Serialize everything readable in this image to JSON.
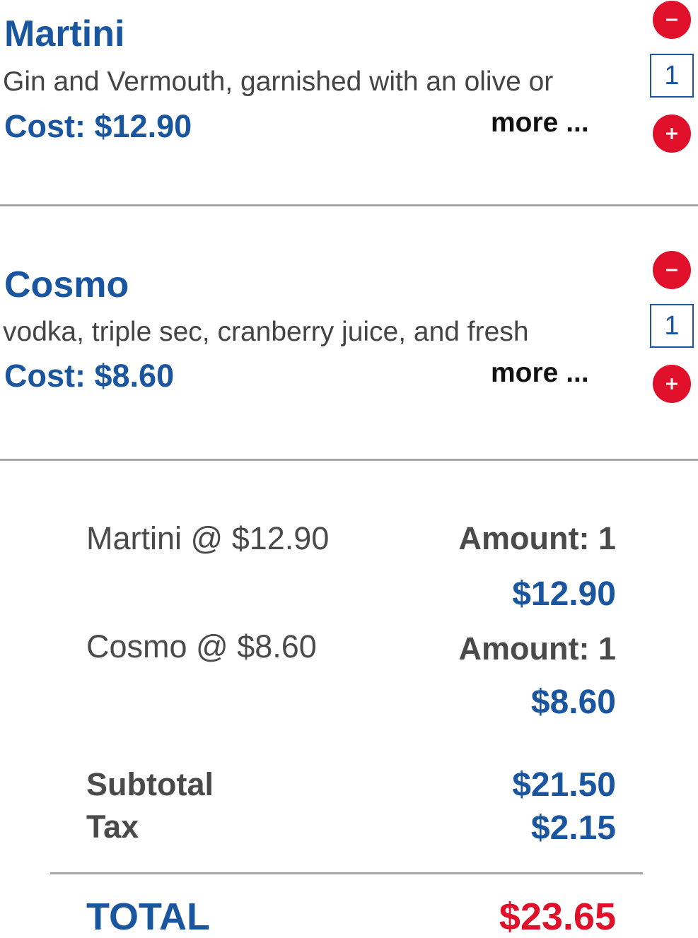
{
  "items": [
    {
      "name": "Martini",
      "description": "Gin and Vermouth, garnished with an olive or",
      "cost": "Cost: $12.90",
      "more": "more ...",
      "quantity": "1"
    },
    {
      "name": "Cosmo",
      "description": "vodka, triple sec, cranberry juice, and fresh",
      "cost": "Cost: $8.60",
      "more": "more ...",
      "quantity": "1"
    }
  ],
  "summary": {
    "lines": [
      {
        "label": "Martini @ $12.90",
        "amount": "Amount: 1",
        "price": "$12.90"
      },
      {
        "label": "Cosmo @ $8.60",
        "amount": "Amount: 1",
        "price": "$8.60"
      }
    ],
    "subtotal_label": "Subtotal",
    "subtotal_value": "$21.50",
    "tax_label": "Tax",
    "tax_value": "$2.15",
    "total_label": "TOTAL",
    "total_value": "$23.65"
  },
  "icons": {
    "decrement": "minus-icon",
    "increment": "plus-icon"
  },
  "colors": {
    "brand_blue": "#1a55a0",
    "accent_red": "#e0102a",
    "text_gray": "#4a4a4a",
    "divider_gray": "#a6a6a6"
  }
}
